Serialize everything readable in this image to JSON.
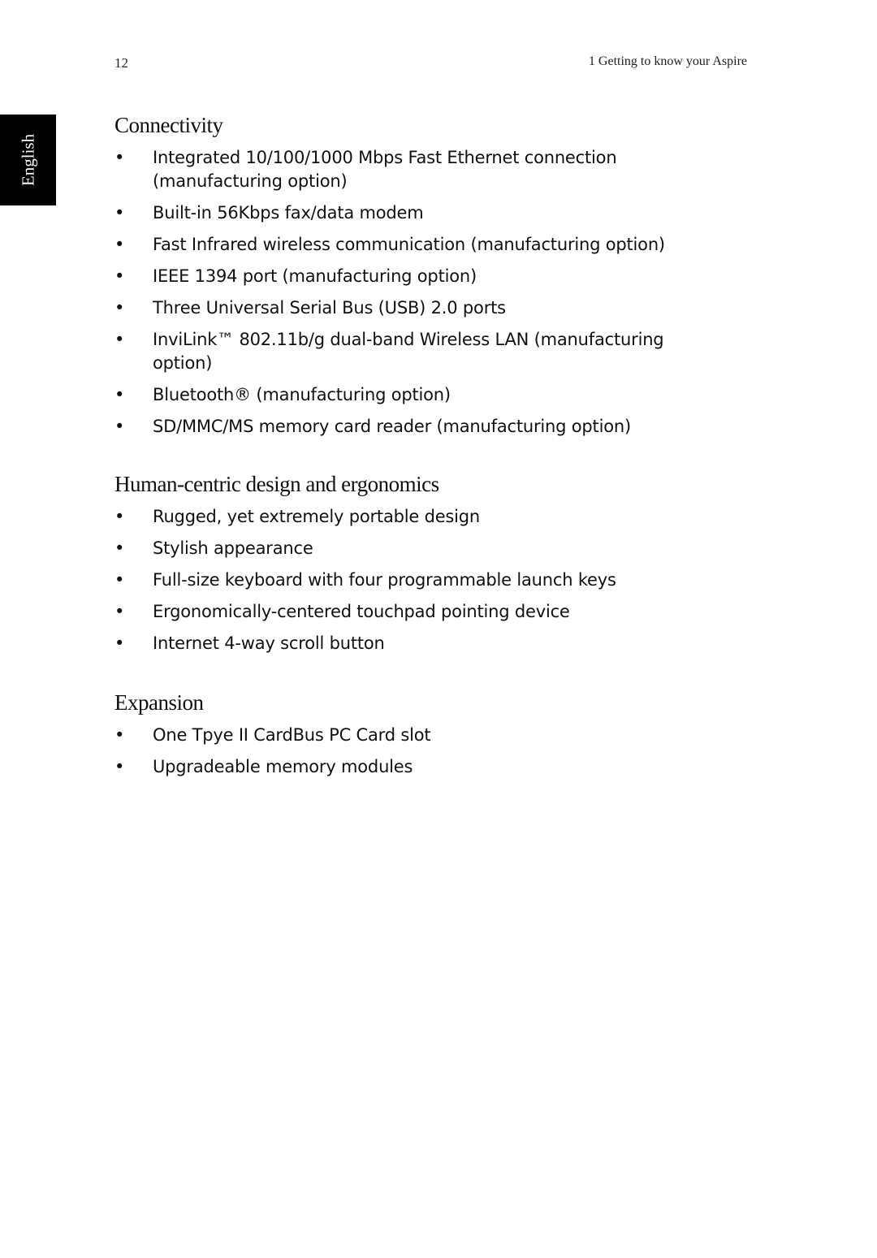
{
  "header": {
    "page_number": "12",
    "chapter": "1 Getting to know your Aspire"
  },
  "language_tab": {
    "label": "English"
  },
  "sections": [
    {
      "title": "Connectivity",
      "items": [
        "Integrated 10/100/1000 Mbps Fast Ethernet connection (manufacturing option)",
        "Built-in 56Kbps fax/data modem",
        "Fast Infrared wireless communication (manufacturing option)",
        "IEEE 1394 port (manufacturing option)",
        "Three Universal Serial Bus (USB) 2.0 ports",
        "InviLink™ 802.11b/g dual-band Wireless LAN (manufacturing option)",
        "Bluetooth® (manufacturing option)",
        "SD/MMC/MS memory card reader (manufacturing option)"
      ]
    },
    {
      "title": "Human-centric design and ergonomics",
      "items": [
        "Rugged, yet extremely portable design",
        "Stylish appearance",
        "Full-size keyboard with four programmable launch keys",
        "Ergonomically-centered touchpad pointing device",
        "Internet 4-way scroll button"
      ]
    },
    {
      "title": "Expansion",
      "items": [
        "One Tpye II CardBus PC Card slot",
        "Upgradeable memory modules"
      ]
    }
  ],
  "bullet_glyph": "•"
}
